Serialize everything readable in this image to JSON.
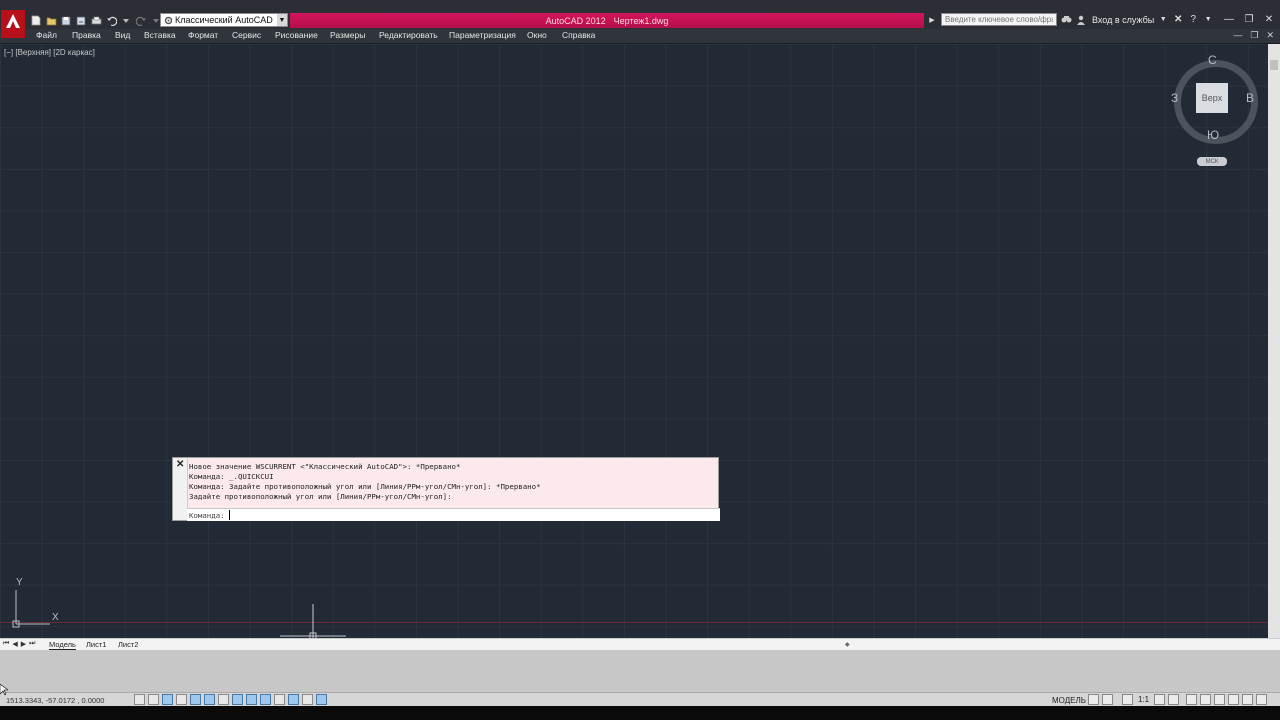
{
  "titlebar": {
    "workspace": "Классический AutoCAD",
    "app_title": "AutoCAD 2012",
    "file_name": "Чертеж1.dwg",
    "search_placeholder": "Введите ключевое слово/фразу",
    "signin_label": "Вход в службы"
  },
  "menu": {
    "items": [
      "Файл",
      "Правка",
      "Вид",
      "Вставка",
      "Формат",
      "Сервис",
      "Рисование",
      "Размеры",
      "Редактировать",
      "Параметризация",
      "Окно",
      "Справка"
    ]
  },
  "viewport": {
    "label": "[−] [Верхняя] [2D каркас]"
  },
  "viewcube": {
    "top_face": "Верх",
    "north": "С",
    "south": "Ю",
    "west": "З",
    "east": "В",
    "wcs_button": "МСК"
  },
  "ucs": {
    "x_label": "X",
    "y_label": "Y"
  },
  "command_window": {
    "lines": [
      "Новое значение WSCURRENT <\"Классический AutoCAD\">: *Прервано*",
      "Команда: _.QUICKCUI",
      "Команда: Задайте противоположный угол или [Линия/РРм-угол/СМн-угол]: *Прервано*",
      "Задайте противоположный угол или [Линия/РРм-угол/СМн-угол]:"
    ],
    "prompt": "Команда:",
    "input_value": ""
  },
  "layout_tabs": {
    "tabs": [
      "Модель",
      "Лист1",
      "Лист2"
    ],
    "active": "Модель"
  },
  "statusbar": {
    "coordinates": "1513.3343, -57.0172 , 0.0000",
    "model_label": "МОДЕЛЬ",
    "scale_label": "1:1"
  },
  "colors": {
    "canvas_bg": "#222a35",
    "title_accent": "#c8124f",
    "logo_red": "#b8101a",
    "command_bg": "#fbe9ec"
  }
}
